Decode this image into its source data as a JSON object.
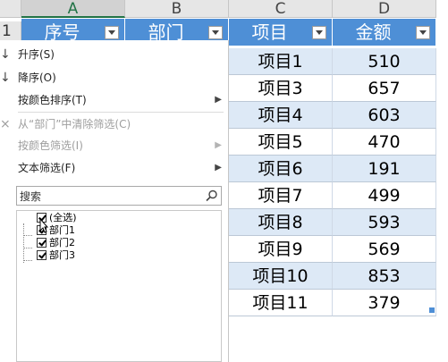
{
  "columns": [
    "A",
    "B",
    "C",
    "D"
  ],
  "row_number": "1",
  "headers": [
    "序号",
    "部门",
    "项目",
    "金额"
  ],
  "rows": [
    {
      "project": "项目1",
      "amount": "510"
    },
    {
      "project": "项目3",
      "amount": "657"
    },
    {
      "project": "项目4",
      "amount": "603"
    },
    {
      "project": "项目5",
      "amount": "470"
    },
    {
      "project": "项目6",
      "amount": "191"
    },
    {
      "project": "项目7",
      "amount": "499"
    },
    {
      "project": "项目8",
      "amount": "593"
    },
    {
      "project": "项目9",
      "amount": "569"
    },
    {
      "project": "项目10",
      "amount": "853"
    },
    {
      "project": "项目11",
      "amount": "379"
    }
  ],
  "menu": {
    "sort_asc": "升序(S)",
    "sort_desc": "降序(O)",
    "sort_color": "按颜色排序(T)",
    "clear_filter": "从“部门”中清除筛选(C)",
    "filter_color": "按颜色筛选(I)",
    "text_filter": "文本筛选(F)"
  },
  "search": {
    "placeholder": "搜索"
  },
  "filter_items": [
    "(全选)",
    "部门1",
    "部门2",
    "部门3"
  ],
  "colors": {
    "header_bg": "#4e8fd6",
    "band_bg": "#dde9f6"
  }
}
